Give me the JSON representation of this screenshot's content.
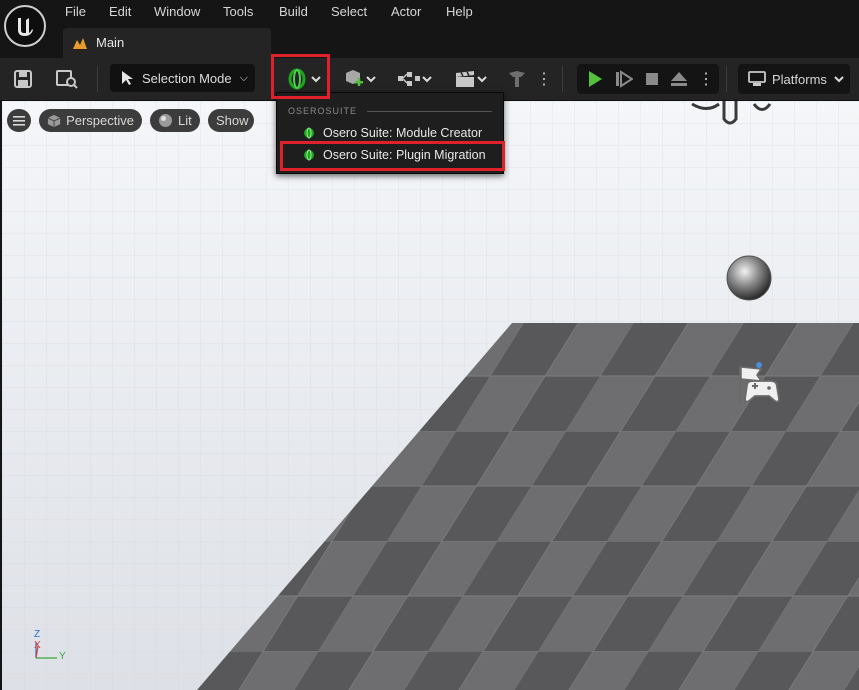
{
  "menu": [
    "File",
    "Edit",
    "Window",
    "Tools",
    "Build",
    "Select",
    "Actor",
    "Help"
  ],
  "tab": {
    "label": "Main"
  },
  "toolbar": {
    "selection_mode": "Selection Mode",
    "platforms": "Platforms"
  },
  "viewport": {
    "perspective": "Perspective",
    "lit": "Lit",
    "show": "Show"
  },
  "dropdown": {
    "section": "OSEROSUITE",
    "items": [
      "Osero Suite: Module Creator",
      "Osero Suite: Plugin Migration"
    ]
  },
  "axis": {
    "z": "Z",
    "x": "X",
    "y": "Y"
  },
  "colors": {
    "highlight": "#e0202a",
    "play_green": "#52c23c",
    "plugin_green": "#1fa51f"
  }
}
